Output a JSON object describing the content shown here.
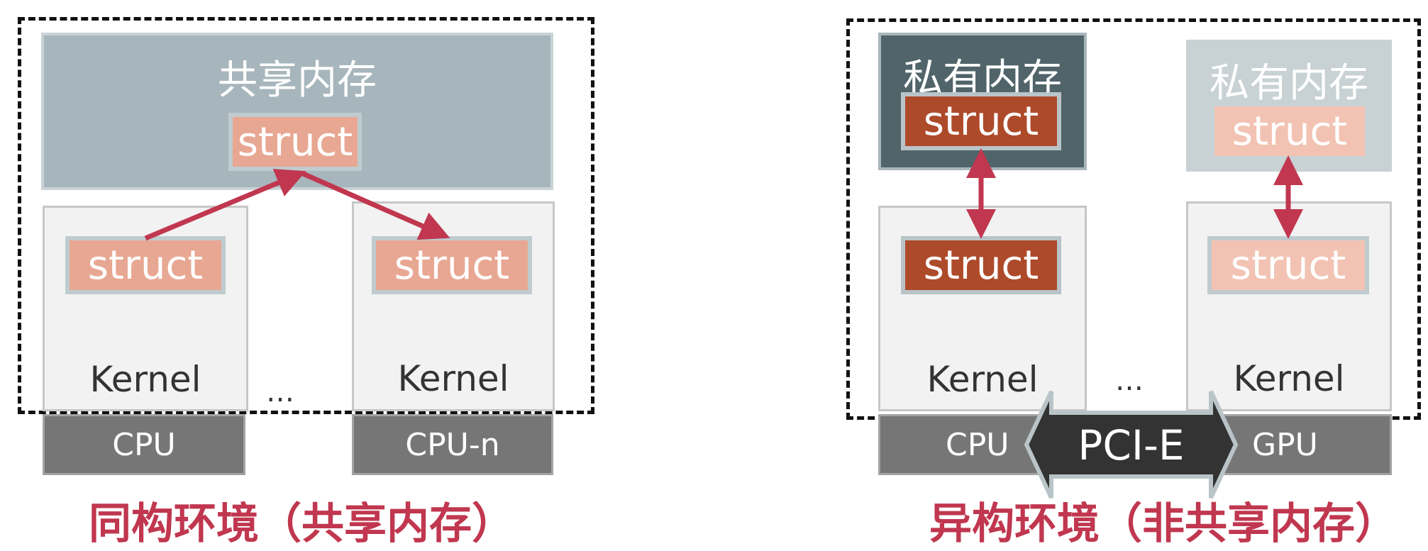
{
  "left": {
    "shared_memory_label": "共享内存",
    "struct_shared": "struct",
    "struct_kernel_1": "struct",
    "struct_kernel_2": "struct",
    "kernel_1": "Kernel",
    "kernel_2": "Kernel",
    "ellipsis": "…",
    "hw_1": "CPU",
    "hw_2": "CPU-n",
    "caption": "同构环境（共享内存）"
  },
  "right": {
    "private_memory_cpu_label": "私有内存",
    "private_memory_gpu_label": "私有内存",
    "struct_cpu_private": "struct",
    "struct_gpu_private": "struct",
    "struct_cpu_kernel": "struct",
    "struct_gpu_kernel": "struct",
    "kernel_cpu": "Kernel",
    "kernel_gpu": "Kernel",
    "ellipsis": "…",
    "hw_cpu": "CPU",
    "hw_gpu": "GPU",
    "bus": "PCI-E",
    "caption": "异构环境（非共享内存）"
  },
  "colors": {
    "arrow": "#c0374f",
    "caption": "#c0374f",
    "struct_salmon": "#e8a792",
    "struct_dark": "#ad4a2a",
    "struct_pale": "#f2c3b3",
    "memory_shared": "#a7b6bc",
    "memory_dark": "#50646a",
    "memory_light": "#c8d1d4",
    "hardware": "#767676",
    "bus": "#333333"
  }
}
